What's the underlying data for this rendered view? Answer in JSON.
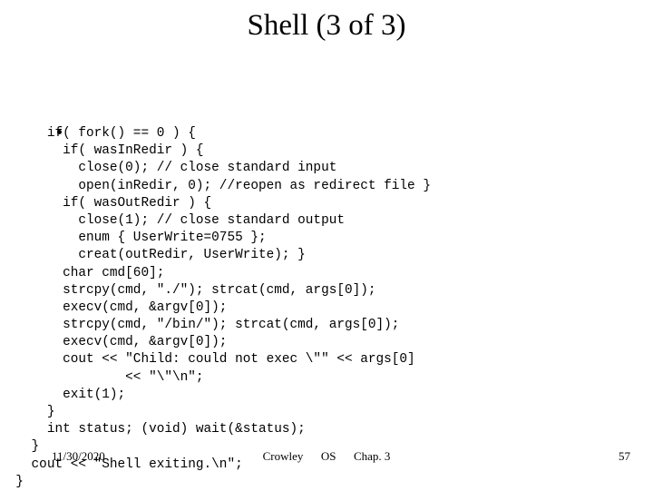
{
  "slide": {
    "title": "Shell (3 of 3)",
    "bullet_glyph": "•",
    "code_lines": [
      "      if( fork() == 0 ) {",
      "        if( wasInRedir ) {",
      "          close(0); // close standard input",
      "          open(inRedir, 0); //reopen as redirect file }",
      "        if( wasOutRedir ) {",
      "          close(1); // close standard output",
      "          enum { UserWrite=0755 };",
      "          creat(outRedir, UserWrite); }",
      "        char cmd[60];",
      "        strcpy(cmd, \"./\"); strcat(cmd, args[0]);",
      "        execv(cmd, &argv[0]);",
      "        strcpy(cmd, \"/bin/\"); strcat(cmd, args[0]);",
      "        execv(cmd, &argv[0]);",
      "        cout << \"Child: could not exec \\\"\" << args[0]",
      "                << \"\\\"\\n\";",
      "        exit(1);",
      "      }",
      "      int status; (void) wait(&status);",
      "    }",
      "    cout << \"Shell exiting.\\n\";",
      "  }"
    ]
  },
  "footer": {
    "date": "11/30/2020",
    "center": "Crowley      OS      Chap. 3",
    "author": "Crowley",
    "course": "OS",
    "chapter": "Chap. 3",
    "page_number": "57"
  },
  "colors": {
    "background": "#ffffff",
    "text": "#000000"
  }
}
